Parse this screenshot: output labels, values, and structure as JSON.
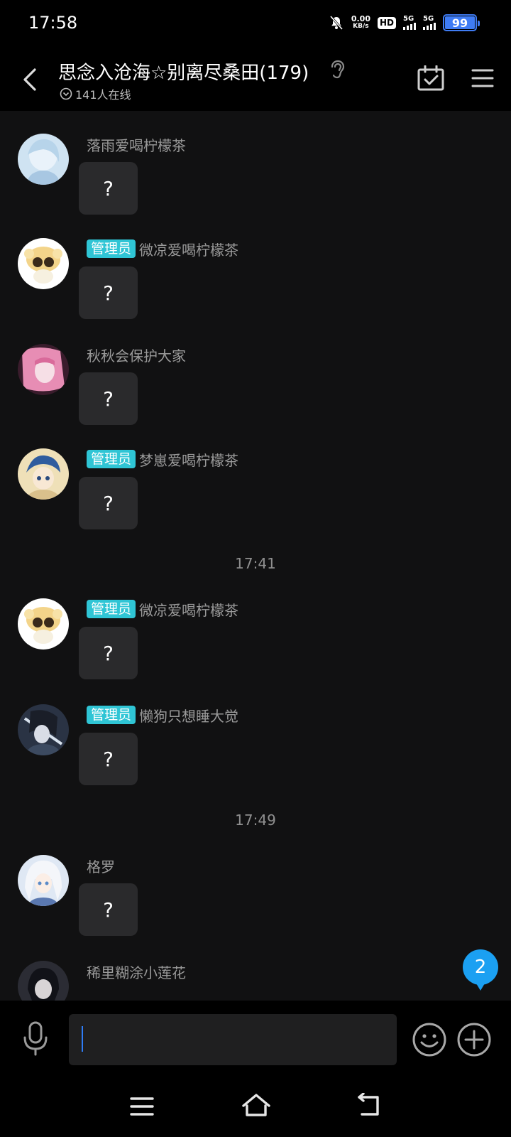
{
  "status_bar": {
    "time": "17:58",
    "net_speed_value": "0.00",
    "net_speed_unit": "KB/s",
    "hd_label": "HD",
    "sim1_label": "5G",
    "sim2_label": "5G",
    "battery": "99"
  },
  "header": {
    "title": "思念入沧海☆别离尽桑田(179)",
    "online_text": "141人在线"
  },
  "colors": {
    "admin_badge": "#2fc5d5",
    "unread_badge": "#1ba0f2",
    "bubble": "#2a2a2c",
    "chat_bg": "#111112"
  },
  "messages": [
    {
      "sender": "落雨爱喝柠檬茶",
      "admin": "",
      "text": "?"
    },
    {
      "sender": "微凉爱喝柠檬茶",
      "admin": "管理员",
      "text": "?"
    },
    {
      "sender": "秋秋会保护大家",
      "admin": "",
      "text": "?"
    },
    {
      "sender": "梦崽爱喝柠檬茶",
      "admin": "管理员",
      "text": "?"
    },
    {
      "sender": "微凉爱喝柠檬茶",
      "admin": "管理员",
      "text": "?"
    },
    {
      "sender": "懒狗只想睡大觉",
      "admin": "管理员",
      "text": "?"
    },
    {
      "sender": "格罗",
      "admin": "",
      "text": "?"
    },
    {
      "sender": "稀里糊涂小莲花",
      "admin": "",
      "text": ""
    }
  ],
  "time_separators": [
    "17:41",
    "17:49"
  ],
  "unread_count": "2",
  "input": {
    "value": "",
    "placeholder": ""
  },
  "icons": {
    "back": "chevron-left-icon",
    "ear": "ear-icon",
    "calendar": "calendar-check-icon",
    "menu": "hamburger-icon",
    "mic": "microphone-icon",
    "emoji": "smiley-icon",
    "plus": "plus-circle-icon"
  }
}
